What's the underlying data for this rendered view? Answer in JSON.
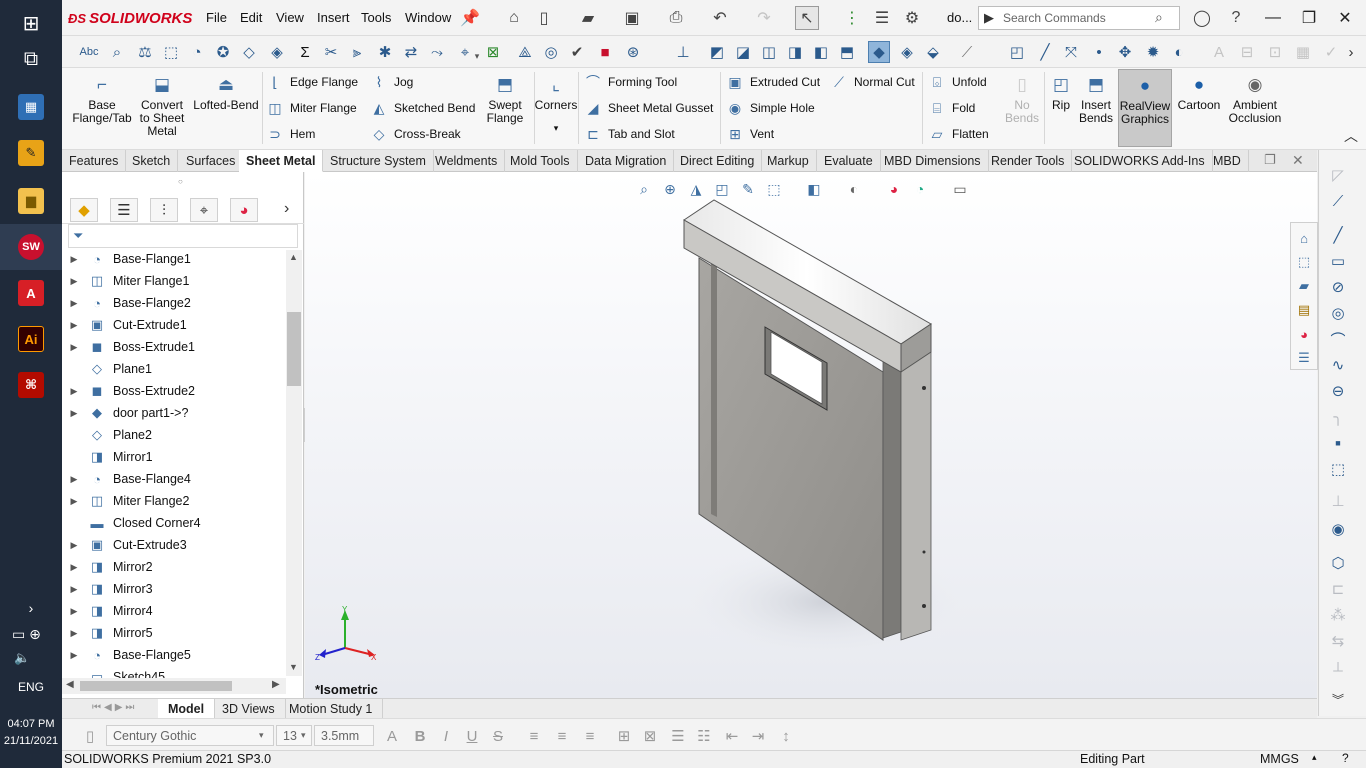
{
  "taskbar": {
    "lang": "ENG",
    "time": "04:07 PM",
    "date": "21/11/2021",
    "apps": [
      {
        "name": "start",
        "glyph": "⊞"
      },
      {
        "name": "task-view",
        "glyph": "⧉"
      },
      {
        "name": "calculator",
        "glyph": "▦"
      },
      {
        "name": "pinned-app",
        "glyph": "✎"
      },
      {
        "name": "file-explorer",
        "glyph": "▆"
      },
      {
        "name": "solidworks",
        "glyph": "SW"
      },
      {
        "name": "acrobat-reader",
        "glyph": "A"
      },
      {
        "name": "illustrator",
        "glyph": "Ai"
      },
      {
        "name": "acrobat",
        "glyph": "⌘"
      }
    ]
  },
  "titlebar": {
    "brand": "SOLIDWORKS",
    "menus": [
      "File",
      "Edit",
      "View",
      "Insert",
      "Tools",
      "Window"
    ],
    "doc_title": "do...",
    "search_placeholder": "Search Commands"
  },
  "ribbon": {
    "base_flange": "Base Flange/Tab",
    "convert": "Convert to Sheet Metal",
    "lofted_bend": "Lofted-Bend",
    "edge_flange": "Edge Flange",
    "miter_flange": "Miter Flange",
    "hem": "Hem",
    "jog": "Jog",
    "sketched_bend": "Sketched Bend",
    "cross_break": "Cross-Break",
    "swept_flange": "Swept Flange",
    "corners": "Corners",
    "forming_tool": "Forming Tool",
    "gusset": "Sheet Metal Gusset",
    "tab_slot": "Tab and Slot",
    "extruded_cut": "Extruded Cut",
    "simple_hole": "Simple Hole",
    "vent": "Vent",
    "normal_cut": "Normal Cut",
    "unfold": "Unfold",
    "fold": "Fold",
    "flatten": "Flatten",
    "no_bends": "No Bends",
    "rip": "Rip",
    "insert_bends": "Insert Bends",
    "realview": "RealView Graphics",
    "cartoon": "Cartoon",
    "ambient": "Ambient Occlusion"
  },
  "tabs": [
    "Features",
    "Sketch",
    "Surfaces",
    "Sheet Metal",
    "Structure System",
    "Weldments",
    "Mold Tools",
    "Data Migration",
    "Direct Editing",
    "Markup",
    "Evaluate",
    "MBD Dimensions",
    "Render Tools",
    "SOLIDWORKS Add-Ins",
    "MBD"
  ],
  "tree": [
    {
      "label": "Base-Flange1",
      "icon": "◔",
      "expand": true
    },
    {
      "label": "Miter Flange1",
      "icon": "◫",
      "expand": true
    },
    {
      "label": "Base-Flange2",
      "icon": "◔",
      "expand": true
    },
    {
      "label": "Cut-Extrude1",
      "icon": "▣",
      "expand": true
    },
    {
      "label": "Boss-Extrude1",
      "icon": "◼",
      "expand": true
    },
    {
      "label": "Plane1",
      "icon": "◇",
      "expand": false
    },
    {
      "label": "Boss-Extrude2",
      "icon": "◼",
      "expand": true
    },
    {
      "label": "door part1->?",
      "icon": "◆",
      "expand": true
    },
    {
      "label": "Plane2",
      "icon": "◇",
      "expand": false
    },
    {
      "label": "Mirror1",
      "icon": "◨",
      "expand": false
    },
    {
      "label": "Base-Flange4",
      "icon": "◔",
      "expand": true
    },
    {
      "label": "Miter Flange2",
      "icon": "◫",
      "expand": true
    },
    {
      "label": "Closed Corner4",
      "icon": "▬",
      "expand": false
    },
    {
      "label": "Cut-Extrude3",
      "icon": "▣",
      "expand": true
    },
    {
      "label": "Mirror2",
      "icon": "◨",
      "expand": true
    },
    {
      "label": "Mirror3",
      "icon": "◨",
      "expand": true
    },
    {
      "label": "Mirror4",
      "icon": "◨",
      "expand": true
    },
    {
      "label": "Mirror5",
      "icon": "◨",
      "expand": true
    },
    {
      "label": "Base-Flange5",
      "icon": "◔",
      "expand": true
    },
    {
      "label": "Sketch45",
      "icon": "▭",
      "expand": false
    }
  ],
  "viewport": {
    "view_label": "*Isometric",
    "axis_x": "X",
    "axis_y": "Y",
    "axis_z": "Z"
  },
  "bottom_tabs": [
    "Model",
    "3D Views",
    "Motion Study 1"
  ],
  "format_bar": {
    "font": "Century Gothic",
    "size": "13",
    "height": "3.5mm"
  },
  "status": {
    "product": "SOLIDWORKS Premium 2021 SP3.0",
    "mode": "Editing Part",
    "units": "MMGS"
  },
  "colors": {
    "taskbar": "#1f2a3a",
    "brand_red": "#d0021b",
    "icon_blue": "#3f6fa1",
    "door_gray": "#9b9a96"
  }
}
